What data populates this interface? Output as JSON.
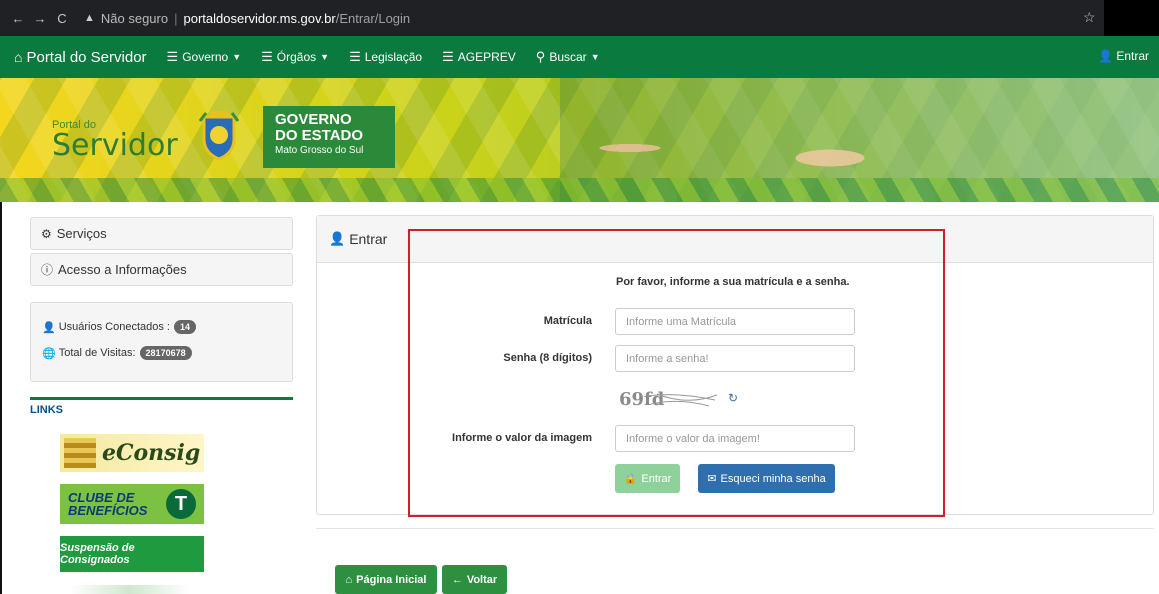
{
  "browser": {
    "not_secure": "Não seguro",
    "domain": "portaldoservidor.ms.gov.br",
    "path": "/Entrar/Login"
  },
  "navbar": {
    "brand": "Portal do Servidor",
    "items": [
      {
        "label": "Governo",
        "icon": "list-icon",
        "dropdown": true
      },
      {
        "label": "Órgãos",
        "icon": "list-icon",
        "dropdown": true
      },
      {
        "label": "Legislação",
        "icon": "list-icon",
        "dropdown": false
      },
      {
        "label": "AGEPREV",
        "icon": "list-icon",
        "dropdown": false
      },
      {
        "label": "Buscar",
        "icon": "search-icon",
        "dropdown": true
      }
    ],
    "login": "Entrar",
    "color": "#0b7a3e"
  },
  "banner": {
    "portal_small": "Portal do",
    "portal_big": "Servidor",
    "gov_line1": "GOVERNO",
    "gov_line2": "DO ESTADO",
    "gov_line3": "Mato Grosso do Sul"
  },
  "sidebar": {
    "servicos": "Serviços",
    "acesso": "Acesso a Informações",
    "usuarios_label": "Usuários Conectados :",
    "usuarios_count": "14",
    "visitas_label": "Total de Visitas:",
    "visitas_count": "28170678",
    "links_title": "LINKS",
    "link_consig": "eConsig",
    "link_clube_1": "CLUBE DE",
    "link_clube_2": "BENEFÍCIOS",
    "link_suspensao": "Suspensão de Consignados"
  },
  "login": {
    "header": "Entrar",
    "instruction": "Por favor, informe a sua matrícula e a senha.",
    "matricula_label": "Matrícula",
    "matricula_placeholder": "Informe uma Matrícula",
    "senha_label": "Senha (8 dígitos)",
    "senha_placeholder": "Informe a senha!",
    "captcha_text": "69fd",
    "imagem_label": "Informe o valor da imagem",
    "imagem_placeholder": "Informe o valor da imagem!",
    "entrar_button": "Entrar",
    "esqueci_button": "Esqueci minha senha"
  },
  "footer_buttons": {
    "home": "Página Inicial",
    "voltar": "Voltar"
  },
  "colors": {
    "accent_green": "#0b7a3e",
    "button_blue": "#2f6fb0",
    "highlight_red": "#d11e2e"
  }
}
